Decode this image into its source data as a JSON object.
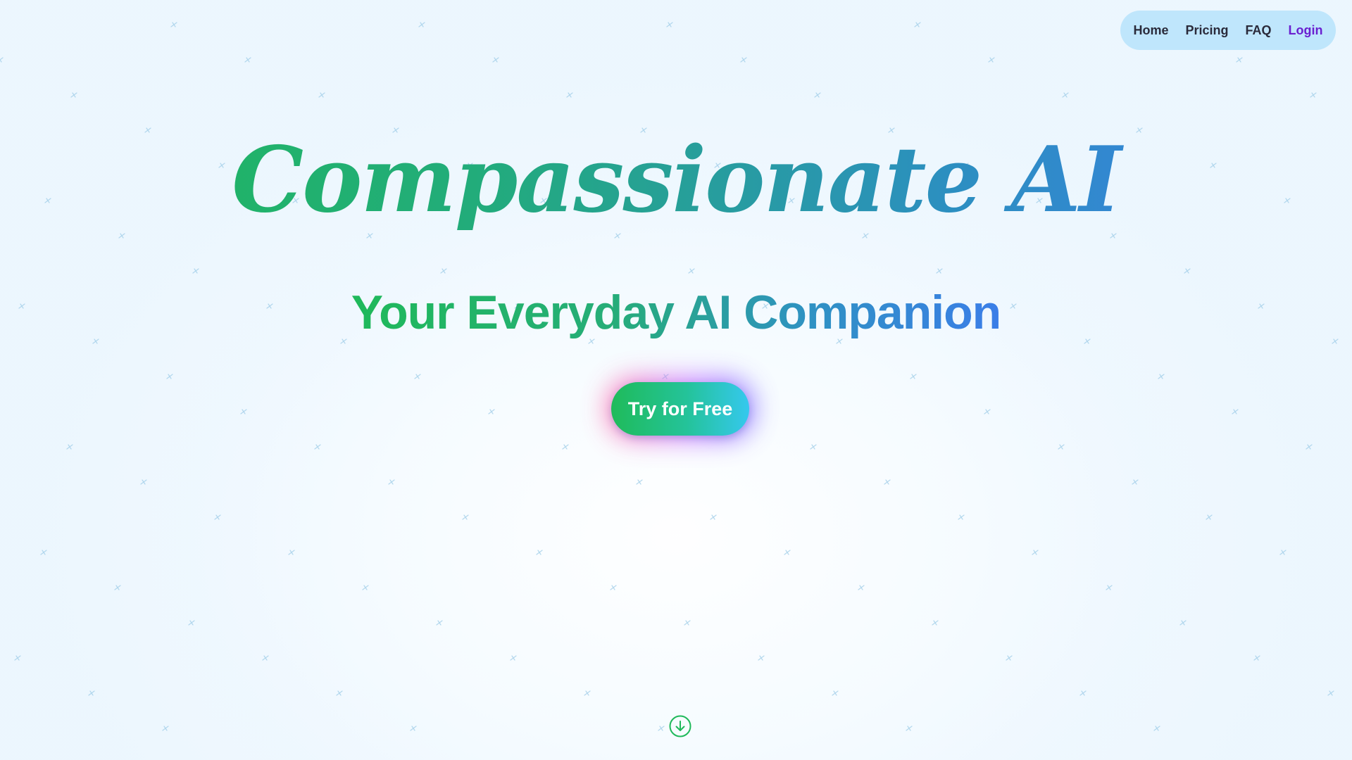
{
  "nav": {
    "items": [
      {
        "label": "Home"
      },
      {
        "label": "Pricing"
      },
      {
        "label": "FAQ"
      },
      {
        "label": "Login"
      }
    ]
  },
  "hero": {
    "title": "Compassionate AI",
    "subtitle": "Your Everyday AI Companion",
    "cta_label": "Try for Free"
  },
  "icons": {
    "scroll": "arrow-down-circle-icon",
    "background": "sparkle-icon"
  },
  "colors": {
    "gradient_start": "#1fb95a",
    "gradient_end": "#3b7ee8",
    "nav_background": "#bfe6fc",
    "login_color": "#6a1fd0",
    "cta_glow": "#c46cff"
  }
}
